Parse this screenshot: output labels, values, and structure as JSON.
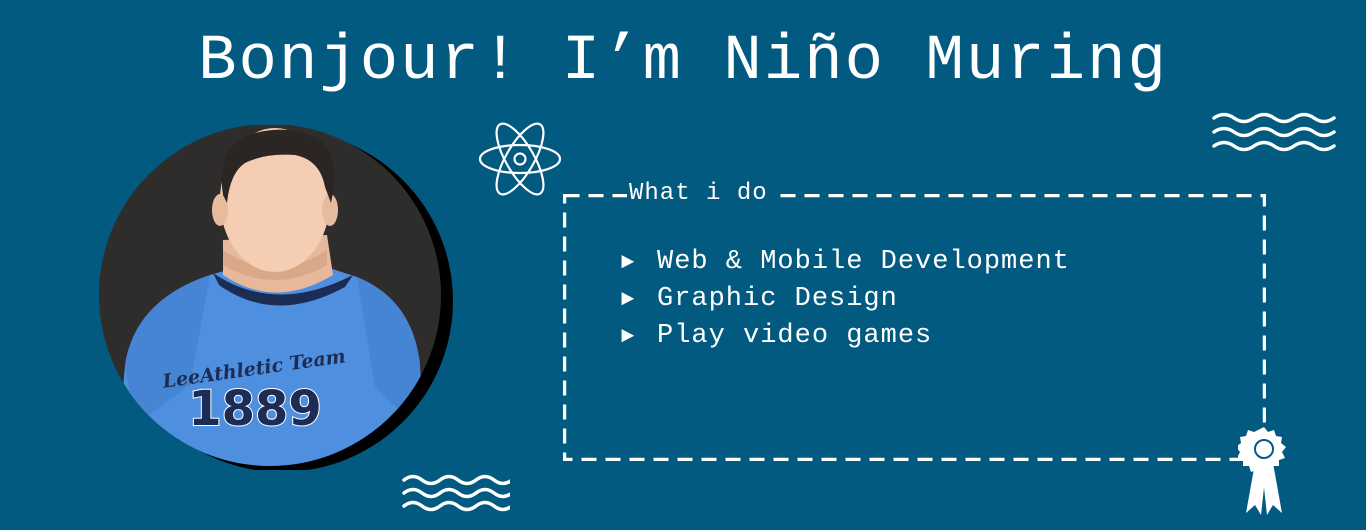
{
  "hero": {
    "title": "Bonjour! I’m Niño Muring",
    "avatar": {
      "shirt_text": "LeeAthletic Team",
      "shirt_number": "1889"
    },
    "what_i_do": {
      "heading": "What i do",
      "items": [
        {
          "bullet": "►",
          "label": "Web & Mobile Development"
        },
        {
          "bullet": "►",
          "label": "Graphic Design"
        },
        {
          "bullet": "►",
          "label": "Play video games"
        }
      ]
    }
  },
  "icons": {
    "atom": "atom-icon",
    "waves_top": "waves-icon",
    "waves_bottom": "waves-icon",
    "ribbon": "award-ribbon-icon"
  },
  "colors": {
    "background": "#025a80",
    "foreground": "#ffffff",
    "avatar_bg": "#2f2d2c",
    "shirt": "#4f8fe0",
    "skin": "#f5cdb2",
    "hair": "#2b2624"
  }
}
